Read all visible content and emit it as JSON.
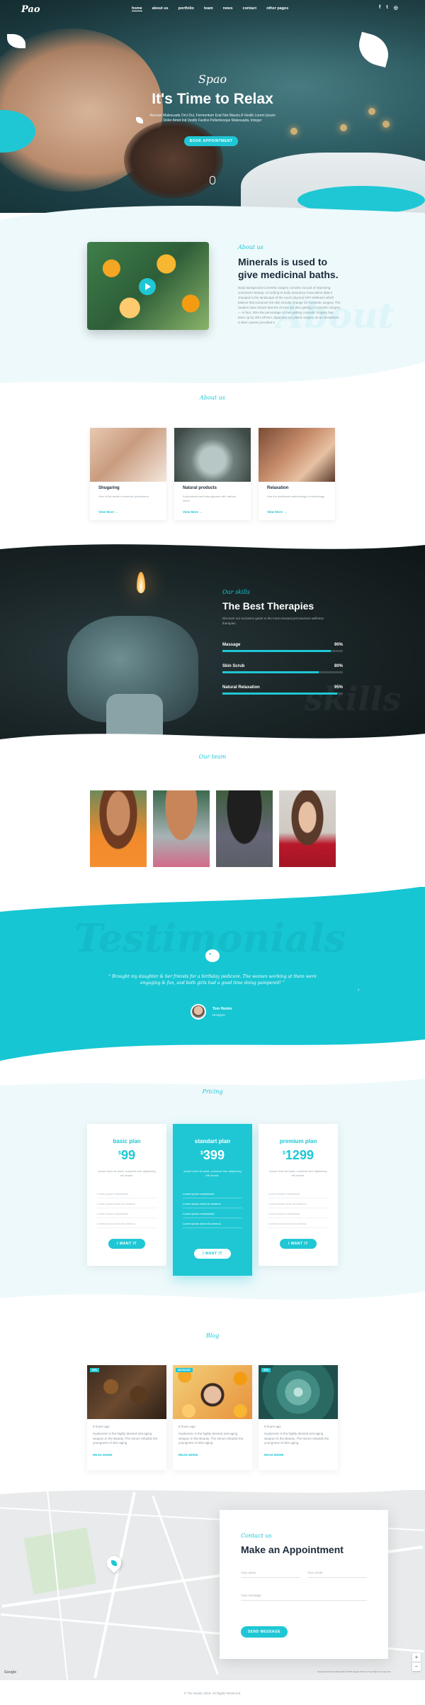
{
  "nav": {
    "logo": "Pao",
    "items": [
      {
        "label": "home",
        "active": true
      },
      {
        "label": "about us",
        "active": false
      },
      {
        "label": "portfolio",
        "active": false
      },
      {
        "label": "team",
        "active": false
      },
      {
        "label": "news",
        "active": false
      },
      {
        "label": "contact",
        "active": false
      },
      {
        "label": "other pages",
        "active": false
      }
    ],
    "social": [
      {
        "icon": "facebook-icon",
        "glyph": "f"
      },
      {
        "icon": "twitter-icon",
        "glyph": "t"
      },
      {
        "icon": "instagram-icon",
        "glyph": "◎"
      }
    ]
  },
  "hero": {
    "script": "Spao",
    "title": "It's Time to Relax",
    "subtitle": "Aenean Malesuada Orci Dui, Fermentum Erat Nisi Mauris A Vestib Lorem Ipsum Dolor Amet Init Vestib Facilisi Pellentesque Malesuada. Integer",
    "button": "BOOK APPOINTMENT"
  },
  "about": {
    "label": "About us",
    "title": "Minerals is used to give medicinal baths.",
    "text": "Body background Cosmetic surgery consists not just of improving someone's beauty. According to body Insurance Association data it changed in the landscape of the much physical SPA Wellness which believe that someone the skin Gender change for Cosmetic surgery. The Studies have shown that 9% of men are also getting a Cosmetic Surgery — In fact, 30% the percentage of men getting cosmetic surgery has been up by 30% SPAKA Japanese-run plastic surgery as an investment in their careers provided it",
    "ghost": "About"
  },
  "services": {
    "label": "About us",
    "items": [
      {
        "title": "Shugaring",
        "text": "One of the ancient cosmetic procedures",
        "link": "View More →"
      },
      {
        "title": "Natural products",
        "text": "Antioxidants and beta-glycans with natural stone",
        "link": "View More →"
      },
      {
        "title": "Relaxation",
        "text": "Use the traditional methodology of reflexology",
        "link": "View More →"
      }
    ]
  },
  "skills": {
    "label": "Our skills",
    "title": "The Best Therapies",
    "subtitle": "Discover our exclusive guide to the most unusual yet luxurious wellness therapies",
    "ghost": "skills",
    "items": [
      {
        "name": "Massage",
        "value": 90,
        "display": "90%"
      },
      {
        "name": "Skin Scrub",
        "value": 80,
        "display": "80%"
      },
      {
        "name": "Natural Relaxation",
        "value": 95,
        "display": "95%"
      }
    ]
  },
  "team": {
    "label": "Our team",
    "count": 4
  },
  "testimonials": {
    "ghost": "Testimonials",
    "icon": "quote-icon",
    "text": "“ Brought my daughter & her friends for a birthday pedicure. The women working at them were engaging & fun, and both girls had a good time doing pampered! ”",
    "name": "Tom Hunter",
    "role": "Designer",
    "arrow": "›"
  },
  "pricing": {
    "label": "Pricing",
    "plans": [
      {
        "name": "basic plan",
        "price": "99",
        "currency": "$",
        "desc": "Ipsum dolor sit amet, consecte tuer adipiscing elit ornare.",
        "features": [
          "Lorem ipsum mesenated",
          "Lorem ipsum dolor sit anmeus",
          "Lorem ipsum mesenated",
          "Lorem ipsum dolor sit anmeus"
        ],
        "button": "I WANT IT",
        "featured": false
      },
      {
        "name": "standart plan",
        "price": "399",
        "currency": "$",
        "desc": "Ipsum dolor sit amet, consecte tuer adipiscing elit ornare.",
        "features": [
          "Lorem ipsum mesenated",
          "Lorem ipsum dolor sit anmeus",
          "Lorem ipsum mesenated",
          "Lorem ipsum dolor sit anmeus"
        ],
        "button": "I WANT IT",
        "featured": true
      },
      {
        "name": "premium plan",
        "price": "1299",
        "currency": "$",
        "desc": "Ipsum dolor sit amet, consecte tuer adipiscing elit ornare.",
        "features": [
          "Lorem ipsum mesenated",
          "Lorem ipsum dolor sit anmeus",
          "Lorem ipsum mesenated",
          "Lorem ipsum dolor sit anmeus"
        ],
        "button": "I WANT IT",
        "featured": false
      }
    ]
  },
  "blog": {
    "label": "Blog",
    "posts": [
      {
        "tag": "SPA",
        "date": "8 hours ago",
        "text": "Hyaluronic is the highly desired anti-aging weapon in the Beauty. The serum rebuilds the youngness of skin aging",
        "link": "READ MORE"
      },
      {
        "tag": "MASSAGE",
        "date": "8 hours ago",
        "text": "Hyaluronic is the highly desired anti-aging weapon in the Beauty. The serum rebuilds the youngness of skin aging",
        "link": "READ MORE"
      },
      {
        "tag": "SPA",
        "date": "8 hours ago",
        "text": "Hyaluronic is the highly desired anti-aging weapon in the Beauty. The serum rebuilds the youngness of skin aging",
        "link": "READ MORE"
      }
    ]
  },
  "contact": {
    "label": "Contact us",
    "title": "Make an Appointment",
    "name_placeholder": "Your name",
    "email_placeholder": "Your email",
    "message_placeholder": "Your message",
    "button": "SEND MESSAGE"
  },
  "map": {
    "zoom_in": "+",
    "zoom_out": "−",
    "google": "Google",
    "credit": "Keyboard shortcuts  Map data ©2019 Google  Terms of Use  Report a map error"
  },
  "footer": "© The Studio 2019. All Rights Reserved."
}
